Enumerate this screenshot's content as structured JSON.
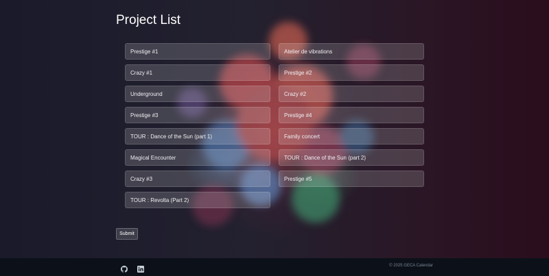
{
  "page": {
    "title": "Project List"
  },
  "projects": [
    "Prestige #1",
    "Atelier de vibrations",
    "Crazy #1",
    "Prestige #2",
    "Underground",
    "Crazy #2",
    "Prestige #3",
    "Prestige #4",
    "TOUR : Dance of the Sun (part 1)",
    "Family concert",
    "Magical Encounter",
    "TOUR : Dance of the Sun (part 2)",
    "Crazy #3",
    "Prestige #5",
    "TOUR : Revolta (Part 2)"
  ],
  "form": {
    "submit_label": "Submit"
  },
  "footer": {
    "icons": [
      "github-icon",
      "linkedin-icon"
    ],
    "copyright": "© 2025 GECA Calendar"
  }
}
